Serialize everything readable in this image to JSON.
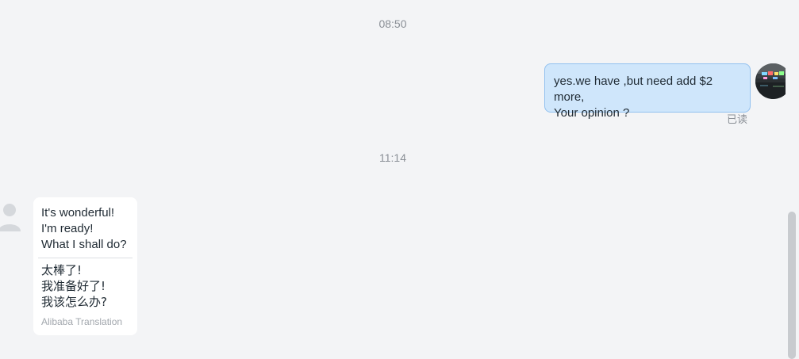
{
  "conversation": {
    "timestamps": [
      "08:50",
      "11:14"
    ],
    "outgoing": {
      "lines": [
        "yes.we have ,but need add $2 more,",
        "Your opinion ?"
      ],
      "status": "已读"
    },
    "incoming": {
      "original_lines": [
        "It's wonderful!",
        "I'm ready!",
        "What I shall do?"
      ],
      "translated_lines": [
        "太棒了!",
        "我准备好了!",
        "我该怎么办?"
      ],
      "translation_credit": "Alibaba Translation"
    }
  },
  "icons": {
    "self_avatar": "self-avatar-image",
    "peer_avatar": "default-user-icon"
  },
  "colors": {
    "page_background": "#f3f4f6",
    "outgoing_bubble": "#cfe6fb",
    "outgoing_border": "#92c1ef",
    "incoming_bubble": "#ffffff",
    "muted_text": "#8a8f96",
    "scrollbar_thumb": "#c8cbcf"
  },
  "scroll": {
    "visible_fraction": 0.41,
    "position_fraction": 1.0
  }
}
